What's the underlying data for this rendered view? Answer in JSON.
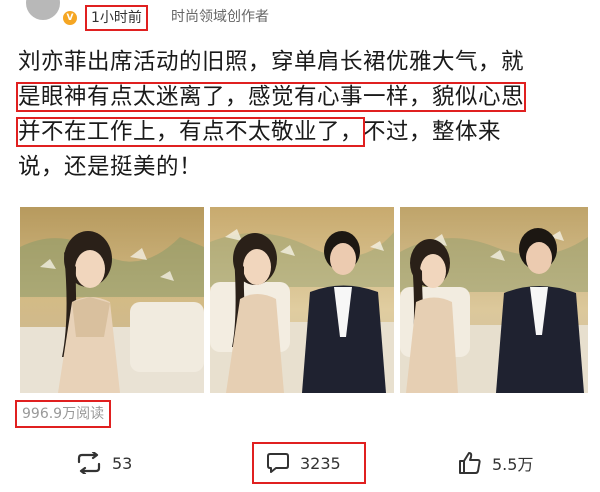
{
  "header": {
    "verified_badge": "V",
    "time": "1小时前",
    "author": "时尚领域创作者"
  },
  "post": {
    "lines": [
      "刘亦菲出席活动的旧照，穿单肩长裙优雅大气，就",
      "是眼神有点太迷离了，感觉有心事一样，貌似心思",
      "并不在工作上，有点不太敬业了，不过，整体来",
      "说，还是挺美的！"
    ],
    "line2_highlight": "是眼神有点太迷离了，感觉有心事一样，貌似心思",
    "line3_highlight": "并不在工作上，有点不太敬业了，",
    "line3_rest": "不过，整体来"
  },
  "photos": [
    {
      "alt": "photo-1"
    },
    {
      "alt": "photo-2"
    },
    {
      "alt": "photo-3"
    }
  ],
  "stats": {
    "reads": "996.9万阅读"
  },
  "actions": {
    "repost_count": "53",
    "comment_count": "3235",
    "like_count": "5.5万"
  },
  "colors": {
    "highlight_border": "#e02020",
    "badge": "#f5a623",
    "muted_text": "#999999"
  }
}
